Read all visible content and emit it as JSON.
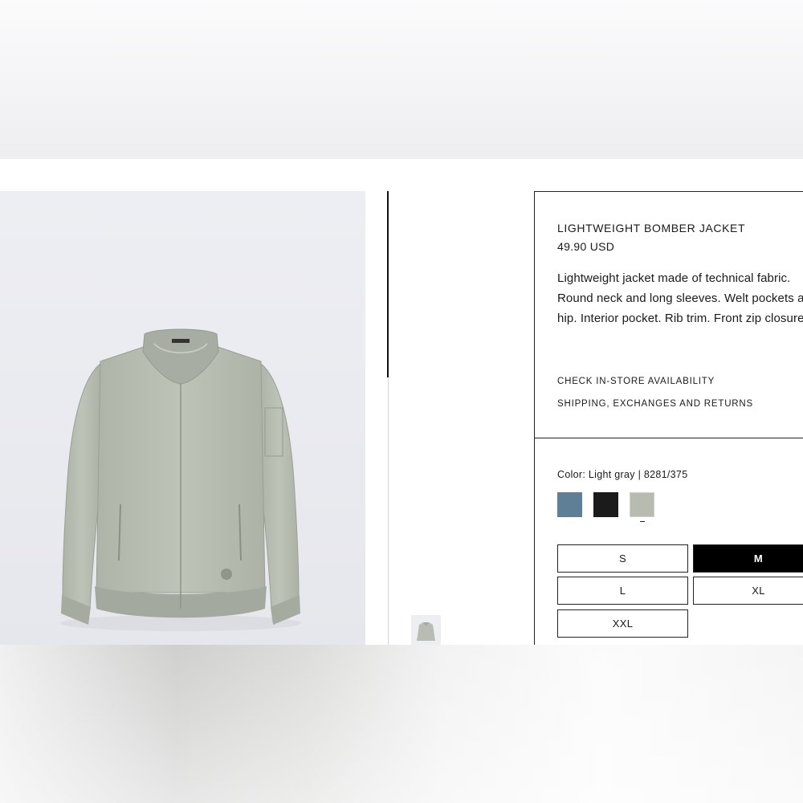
{
  "product": {
    "name": "LIGHTWEIGHT BOMBER JACKET",
    "price": "49.90 USD",
    "description": "Lightweight jacket made of technical fabric. Round neck and long sleeves. Welt pockets at hip. Interior pocket. Rib trim. Front zip closure.",
    "links": {
      "availability": "CHECK IN-STORE AVAILABILITY",
      "shipping": "SHIPPING, EXCHANGES AND RETURNS"
    }
  },
  "color": {
    "label": "Color: Light gray | 8281/375",
    "swatches": [
      {
        "name": "Blue",
        "hex": "#5f7f97"
      },
      {
        "name": "Black",
        "hex": "#1b1b1b"
      },
      {
        "name": "Light gray",
        "hex": "#b8bbb0",
        "selected": true
      }
    ]
  },
  "sizes": [
    {
      "label": "S",
      "selected": false
    },
    {
      "label": "M",
      "selected": true
    },
    {
      "label": "L",
      "selected": false
    },
    {
      "label": "XL",
      "selected": false
    },
    {
      "label": "XXL",
      "selected": false
    }
  ],
  "colors": {
    "jacket": "#b7bdb2",
    "jacket_shadow": "#9ea497",
    "rib": "#a3a99e",
    "photo_bg": "#ebecf1"
  }
}
